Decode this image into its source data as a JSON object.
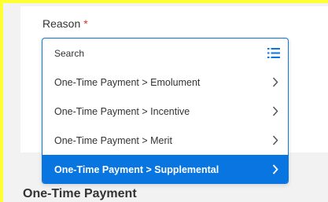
{
  "field": {
    "label": "Reason",
    "required_marker": "*"
  },
  "dropdown": {
    "search_placeholder": "Search",
    "options": [
      {
        "label": "One-Time Payment > Emolument",
        "selected": false
      },
      {
        "label": "One-Time Payment > Incentive",
        "selected": false
      },
      {
        "label": "One-Time Payment > Merit",
        "selected": false
      },
      {
        "label": "One-Time Payment > Supplemental",
        "selected": true
      }
    ]
  },
  "section": {
    "title": "One-Time Payment"
  },
  "icons": {
    "list": "list-icon",
    "chevron": "chevron-right-icon"
  },
  "colors": {
    "accent": "#0875e1",
    "required": "#de2e21",
    "highlight_border": "#ffff33",
    "text": "#333333"
  }
}
